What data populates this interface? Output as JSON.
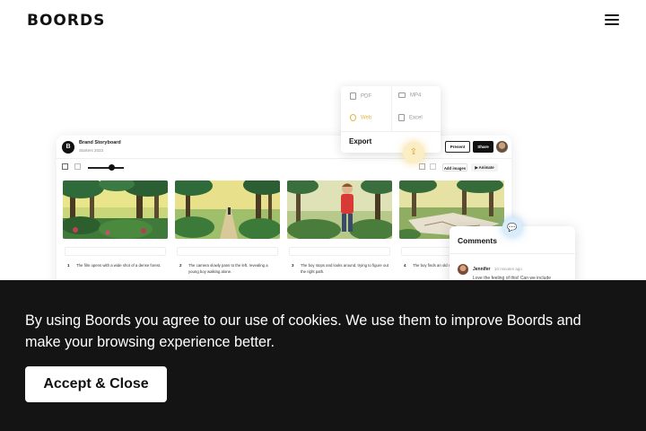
{
  "header": {
    "logo_text": "BOORDS",
    "menu_icon": "hamburger-menu-icon"
  },
  "app_preview": {
    "title": "Brand Storyboard",
    "subtitle": "Starters 2023",
    "present_label": "Present",
    "share_label": "Share",
    "add_images_label": "Add images",
    "animate_label": "▶ Animate",
    "frames": [
      {
        "number": "1",
        "text": "The film opens with a wide shot of a dense forest."
      },
      {
        "number": "2",
        "text": "The camera slowly pans to the left, revealing a young boy walking alone."
      },
      {
        "number": "3",
        "text": "The boy stops and looks around, trying to figure out the right path."
      },
      {
        "number": "4",
        "text": "The boy finds an old map tucked in his backpack."
      }
    ]
  },
  "export_menu": {
    "items": [
      {
        "label": "PDF",
        "icon": "pdf-icon"
      },
      {
        "label": "MP4",
        "icon": "video-icon"
      },
      {
        "label": "Web",
        "icon": "link-icon"
      },
      {
        "label": "Excel",
        "icon": "table-icon"
      }
    ],
    "title": "Export",
    "accent_color": "#e3b449"
  },
  "comments_panel": {
    "title": "Comments",
    "author": "Jennifer",
    "time": "10 minutes ago",
    "text": "Love the feeling of this! Can we include"
  },
  "cookie_banner": {
    "message": "By using Boords you agree to our use of cookies. We use them to improve Boords and make your browsing experience better.",
    "accept_label": "Accept & Close",
    "background": "#141414"
  }
}
